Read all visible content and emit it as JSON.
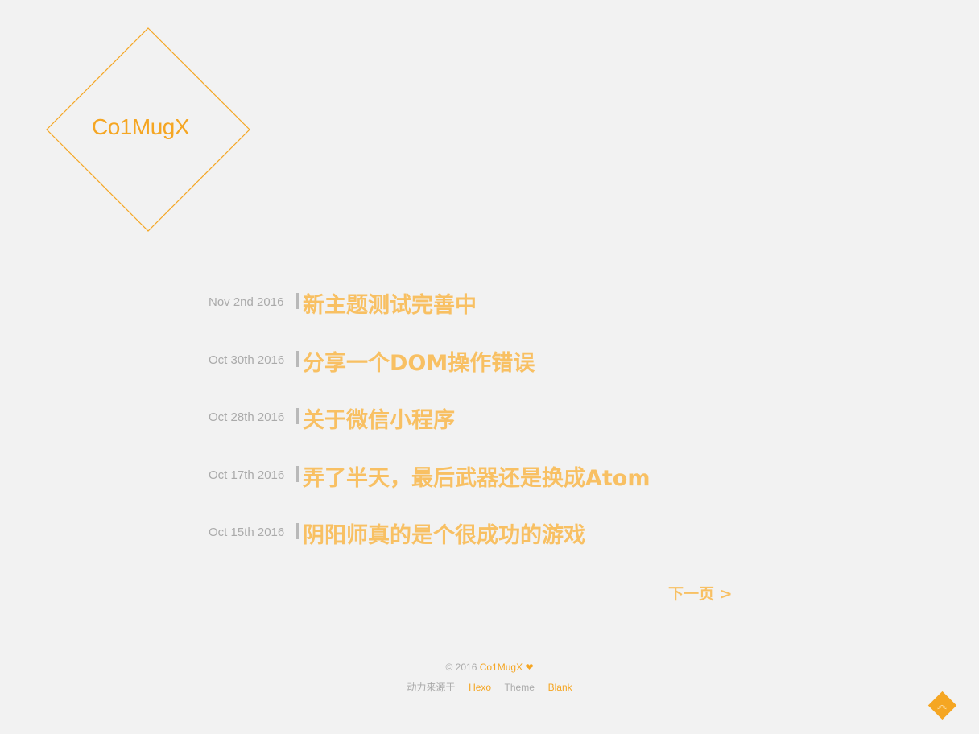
{
  "site": {
    "logo_text": "Co1MugX",
    "accent_color": "#f5a623"
  },
  "posts": [
    {
      "date": "Nov 2nd 2016",
      "title": "新主题测试完善中"
    },
    {
      "date": "Oct 30th 2016",
      "title": "分享一个DOM操作错误"
    },
    {
      "date": "Oct 28th 2016",
      "title": "关于微信小程序"
    },
    {
      "date": "Oct 17th 2016",
      "title": "弄了半天，最后武器还是换成Atom"
    },
    {
      "date": "Oct 15th 2016",
      "title": "阴阳师真的是个很成功的游戏"
    }
  ],
  "pagination": {
    "next_label": "下一页 >"
  },
  "footer": {
    "copyright": "© 2016",
    "author": "Co1MugX",
    "heart": "❤",
    "powered_by": "动力来源于",
    "hexo": "Hexo",
    "theme_label": "Theme",
    "theme_name": "Blank"
  },
  "back_to_top": {
    "icon": "chevron-up-double-icon",
    "glyph": "︽"
  }
}
